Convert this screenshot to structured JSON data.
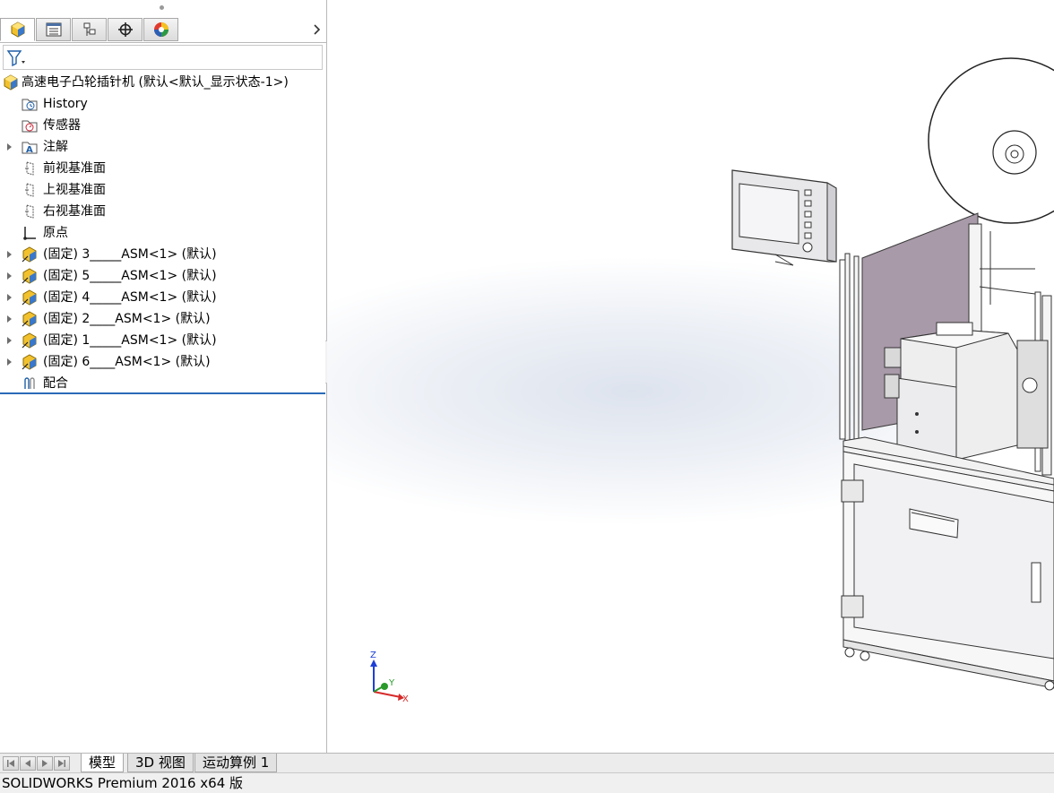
{
  "panel": {
    "tabs": [
      "featuremanager-tab",
      "propertymanager-tab",
      "configurationmanager-tab",
      "dimxpert-tab",
      "display-manager-tab"
    ],
    "active_tab": 0
  },
  "tree": {
    "root": "高速电子凸轮插针机  (默认<默认_显示状态-1>)",
    "items": [
      {
        "label": "History",
        "icon": "history-folder-icon",
        "expandable": false
      },
      {
        "label": "传感器",
        "icon": "sensors-folder-icon",
        "expandable": false
      },
      {
        "label": "注解",
        "icon": "annotations-folder-icon",
        "expandable": true
      },
      {
        "label": "前视基准面",
        "icon": "plane-icon",
        "expandable": false
      },
      {
        "label": "上视基准面",
        "icon": "plane-icon",
        "expandable": false
      },
      {
        "label": "右视基准面",
        "icon": "plane-icon",
        "expandable": false
      },
      {
        "label": "原点",
        "icon": "origin-icon",
        "expandable": false
      },
      {
        "label": "(固定) 3_____ASM<1> (默认)",
        "icon": "subassembly-icon",
        "expandable": true
      },
      {
        "label": "(固定) 5_____ASM<1> (默认)",
        "icon": "subassembly-icon",
        "expandable": true
      },
      {
        "label": "(固定) 4_____ASM<1> (默认)",
        "icon": "subassembly-icon",
        "expandable": true
      },
      {
        "label": "(固定) 2____ASM<1> (默认)",
        "icon": "subassembly-icon",
        "expandable": true
      },
      {
        "label": "(固定) 1_____ASM<1> (默认)",
        "icon": "subassembly-icon",
        "expandable": true
      },
      {
        "label": "(固定) 6____ASM<1> (默认)",
        "icon": "subassembly-icon",
        "expandable": true
      },
      {
        "label": "配合",
        "icon": "mates-icon",
        "expandable": false
      }
    ]
  },
  "triad": {
    "z": "Z",
    "y": "Y",
    "x": "X"
  },
  "bottom_tabs": [
    {
      "label": "模型",
      "active": true
    },
    {
      "label": "3D 视图",
      "active": false
    },
    {
      "label": "运动算例 1",
      "active": false
    }
  ],
  "status": "SOLIDWORKS Premium 2016 x64 版"
}
